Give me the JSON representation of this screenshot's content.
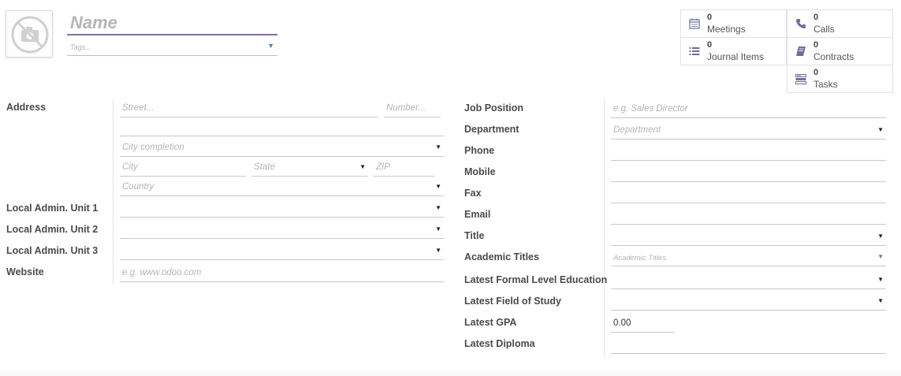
{
  "header": {
    "name_placeholder": "Name",
    "tags_placeholder": "Tags..."
  },
  "smart_buttons": [
    {
      "count": "0",
      "label": "Meetings",
      "icon": "calendar-icon"
    },
    {
      "count": "0",
      "label": "Calls",
      "icon": "phone-icon"
    },
    {
      "count": "0",
      "label": "Journal Items",
      "icon": "list-icon"
    },
    {
      "count": "0",
      "label": "Contracts",
      "icon": "book-icon"
    },
    {
      "count": "0",
      "label": "Tasks",
      "icon": "tasks-icon"
    }
  ],
  "address": {
    "label": "Address",
    "street_placeholder": "Street...",
    "number_placeholder": "Number...",
    "city_completion_placeholder": "City completion",
    "city_placeholder": "City",
    "state_placeholder": "State",
    "zip_placeholder": "ZIP",
    "country_placeholder": "Country"
  },
  "left_fields": {
    "local_admin_1": "Local Admin. Unit 1",
    "local_admin_2": "Local Admin. Unit 2",
    "local_admin_3": "Local Admin. Unit 3",
    "website": "Website",
    "website_placeholder": "e.g. www.odoo.com"
  },
  "right_fields": {
    "job_position": "Job Position",
    "job_position_placeholder": "e.g. Sales Director",
    "department": "Department",
    "department_placeholder": "Department",
    "phone": "Phone",
    "mobile": "Mobile",
    "fax": "Fax",
    "email": "Email",
    "title": "Title",
    "academic_titles": "Academic Titles",
    "academic_titles_placeholder": "Academic Titles",
    "latest_education": "Latest Formal Level Education",
    "latest_field_of_study": "Latest Field of Study",
    "latest_gpa": "Latest GPA",
    "latest_gpa_value": "0.00",
    "latest_diploma": "Latest Diploma"
  },
  "colors": {
    "accent": "#7c6fa8",
    "icon": "#6b6f9a",
    "dropdown_caret_blue": "#5d7fa8"
  }
}
